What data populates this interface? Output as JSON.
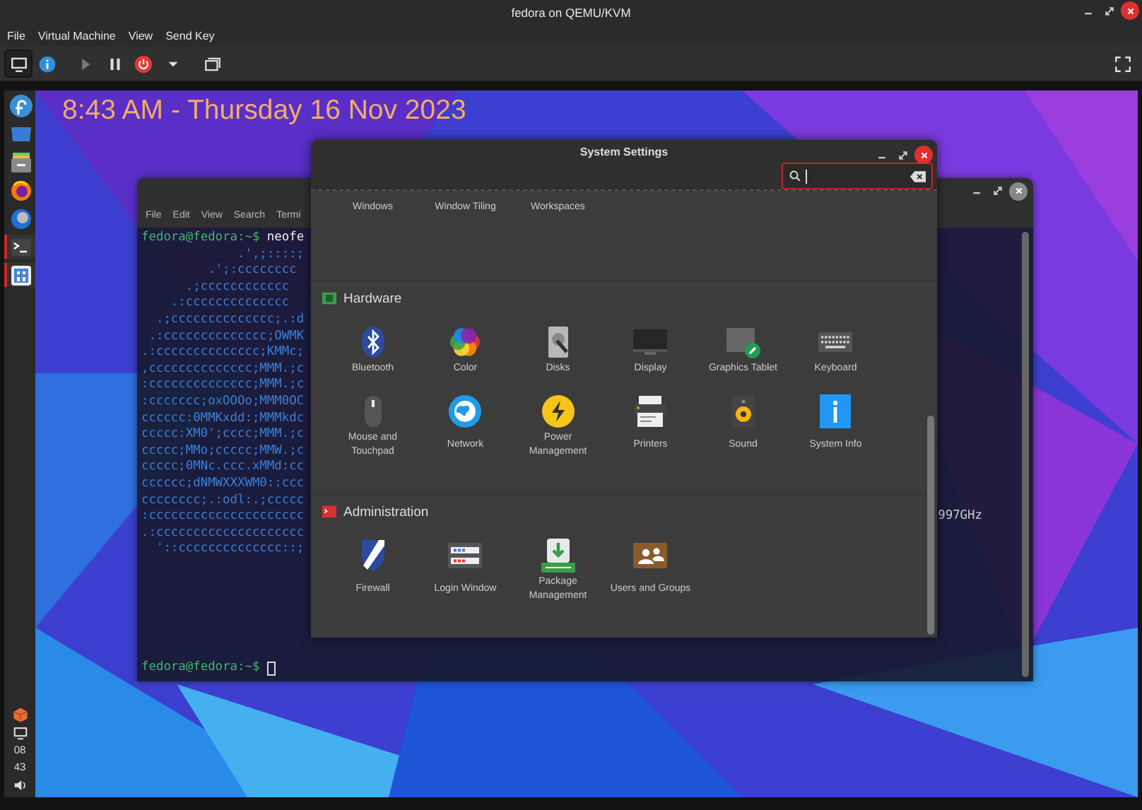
{
  "window": {
    "title": "fedora on QEMU/KVM"
  },
  "menu": [
    "File",
    "Virtual Machine",
    "View",
    "Send Key"
  ],
  "toolbar": [
    {
      "kind": "console",
      "selected": true,
      "disabled": false
    },
    {
      "kind": "details",
      "selected": false,
      "disabled": false
    },
    {
      "kind": "run",
      "selected": false,
      "disabled": true
    },
    {
      "kind": "pause",
      "selected": false,
      "disabled": false
    },
    {
      "kind": "shutdown",
      "selected": false,
      "disabled": false
    },
    {
      "kind": "menu",
      "selected": false,
      "disabled": false
    },
    {
      "kind": "snapshots",
      "selected": false,
      "disabled": false
    },
    {
      "kind": "fullscreen",
      "selected": false,
      "disabled": false
    }
  ],
  "guest": {
    "clock": "8:43 AM - Thursday 16 Nov 2023",
    "panel": {
      "launchers": [
        {
          "kind": "start",
          "running": false
        },
        {
          "kind": "desktop",
          "running": false
        },
        {
          "kind": "files",
          "running": false
        },
        {
          "kind": "browser",
          "running": false
        },
        {
          "kind": "mail",
          "running": false
        },
        {
          "kind": "terminal",
          "running": true
        },
        {
          "kind": "app",
          "running": true
        }
      ],
      "tray": [
        {
          "kind": "package"
        },
        {
          "kind": "display"
        },
        {
          "kind": "clock",
          "hours": "08",
          "minutes": "43"
        },
        {
          "kind": "volume"
        }
      ]
    },
    "terminal": {
      "menu": [
        "File",
        "Edit",
        "View",
        "Search",
        "Termi"
      ],
      "lines": [
        {
          "kind": "prompt",
          "prompt": "fedora@fedora:~$",
          "command": " neofe"
        },
        {
          "kind": "art",
          "text": "             .',;::::;"
        },
        {
          "kind": "art",
          "text": "         .';:cccccccc"
        },
        {
          "kind": "art",
          "text": "      .;cccccccccccc"
        },
        {
          "kind": "art",
          "text": "    .:cccccccccccccc"
        },
        {
          "kind": "art",
          "text": "  .;cccccccccccccc;.:d"
        },
        {
          "kind": "art",
          "text": " .:cccccccccccccc;OWMK"
        },
        {
          "kind": "art",
          "text": ".:cccccccccccccc;KMMc;"
        },
        {
          "kind": "art",
          "text": ",cccccccccccccc;MMM.;c"
        },
        {
          "kind": "art",
          "text": ":cccccccccccccc;MMM.;c"
        },
        {
          "kind": "art",
          "text": ":ccccccc;oxOOOo;MMM0OC"
        },
        {
          "kind": "art",
          "text": "cccccc:0MMKxdd:;MMMkdc"
        },
        {
          "kind": "art",
          "text": "ccccc:XM0';cccc;MMM.;c"
        },
        {
          "kind": "art",
          "text": "ccccc;MMo;ccccc;MMW.;c"
        },
        {
          "kind": "art",
          "text": "ccccc;0MNc.ccc.xMMd:cc"
        },
        {
          "kind": "art",
          "text": "cccccc;dNMWXXXWM0::ccc"
        },
        {
          "kind": "art",
          "text": "cccccccc;.:odl:.;ccccc"
        },
        {
          "kind": "art",
          "text": ":ccccccccccccccccccccc",
          "info": "997GHz"
        },
        {
          "kind": "art",
          "text": ".:cccccccccccccccccccc"
        },
        {
          "kind": "art",
          "text": "  '::cccccccccccccc::;"
        },
        {
          "kind": "prompt",
          "prompt": "fedora@fedora:~$",
          "cursor": true
        }
      ]
    },
    "settings": {
      "title": "System Settings",
      "search": {
        "focused": true
      },
      "partial_items": [
        "Windows",
        "Window Tiling",
        "Workspaces"
      ],
      "sections": [
        {
          "kind": "hardware",
          "title": "Hardware",
          "items": [
            {
              "kind": "bluetooth",
              "label": "Bluetooth"
            },
            {
              "kind": "color",
              "label": "Color"
            },
            {
              "kind": "disks",
              "label": "Disks"
            },
            {
              "kind": "display",
              "label": "Display"
            },
            {
              "kind": "tablet",
              "label": "Graphics Tablet"
            },
            {
              "kind": "keyboard",
              "label": "Keyboard"
            },
            {
              "kind": "mouse",
              "label": "Mouse and Touchpad"
            },
            {
              "kind": "network",
              "label": "Network"
            },
            {
              "kind": "power",
              "label": "Power Management"
            },
            {
              "kind": "printers",
              "label": "Printers"
            },
            {
              "kind": "sound",
              "label": "Sound"
            },
            {
              "kind": "sysinfo",
              "label": "System Info"
            }
          ]
        },
        {
          "kind": "admin",
          "title": "Administration",
          "items": [
            {
              "kind": "firewall",
              "label": "Firewall"
            },
            {
              "kind": "login",
              "label": "Login Window"
            },
            {
              "kind": "package",
              "label": "Package Management"
            },
            {
              "kind": "users",
              "label": "Users and Groups"
            }
          ]
        }
      ]
    }
  }
}
